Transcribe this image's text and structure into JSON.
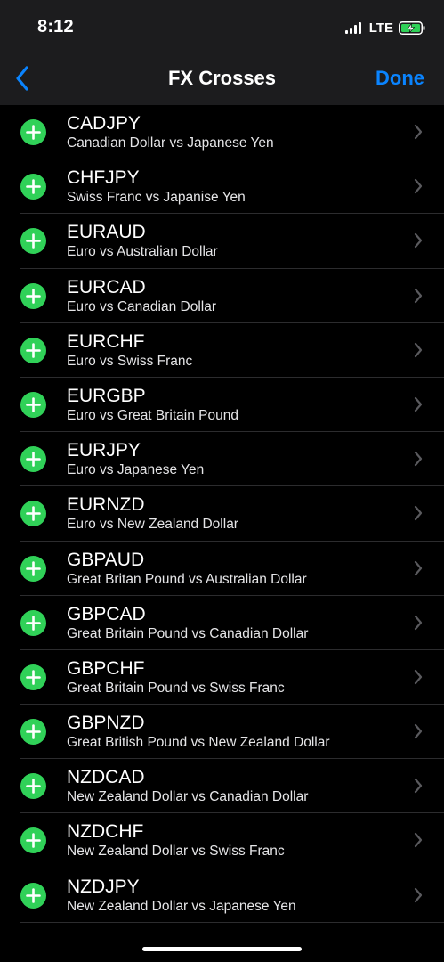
{
  "status_bar": {
    "time": "8:12",
    "network": "LTE",
    "signal_icon": "cellular-signal-icon",
    "battery_icon": "battery-charging-icon"
  },
  "nav": {
    "back_icon": "chevron-left-icon",
    "title": "FX Crosses",
    "done_label": "Done"
  },
  "colors": {
    "accent": "#0a84ff",
    "add_green": "#30d158",
    "background": "#000000",
    "header_bg": "#1c1c1e"
  },
  "rows": [
    {
      "symbol": "CADJPY",
      "description": "Canadian Dollar vs Japanese Yen"
    },
    {
      "symbol": "CHFJPY",
      "description": "Swiss Franc vs Japanise Yen"
    },
    {
      "symbol": "EURAUD",
      "description": "Euro vs Australian Dollar"
    },
    {
      "symbol": "EURCAD",
      "description": "Euro vs Canadian Dollar"
    },
    {
      "symbol": "EURCHF",
      "description": "Euro vs Swiss Franc"
    },
    {
      "symbol": "EURGBP",
      "description": "Euro vs Great Britain Pound"
    },
    {
      "symbol": "EURJPY",
      "description": "Euro vs Japanese Yen"
    },
    {
      "symbol": "EURNZD",
      "description": "Euro vs New Zealand Dollar"
    },
    {
      "symbol": "GBPAUD",
      "description": "Great Britan Pound vs Australian Dollar"
    },
    {
      "symbol": "GBPCAD",
      "description": "Great Britain Pound vs Canadian Dollar"
    },
    {
      "symbol": "GBPCHF",
      "description": "Great Britain Pound vs Swiss Franc"
    },
    {
      "symbol": "GBPNZD",
      "description": "Great British Pound vs New Zealand Dollar"
    },
    {
      "symbol": "NZDCAD",
      "description": "New Zealand Dollar vs Canadian Dollar"
    },
    {
      "symbol": "NZDCHF",
      "description": "New Zealand Dollar vs Swiss Franc"
    },
    {
      "symbol": "NZDJPY",
      "description": "New Zealand Dollar vs Japanese Yen"
    }
  ]
}
